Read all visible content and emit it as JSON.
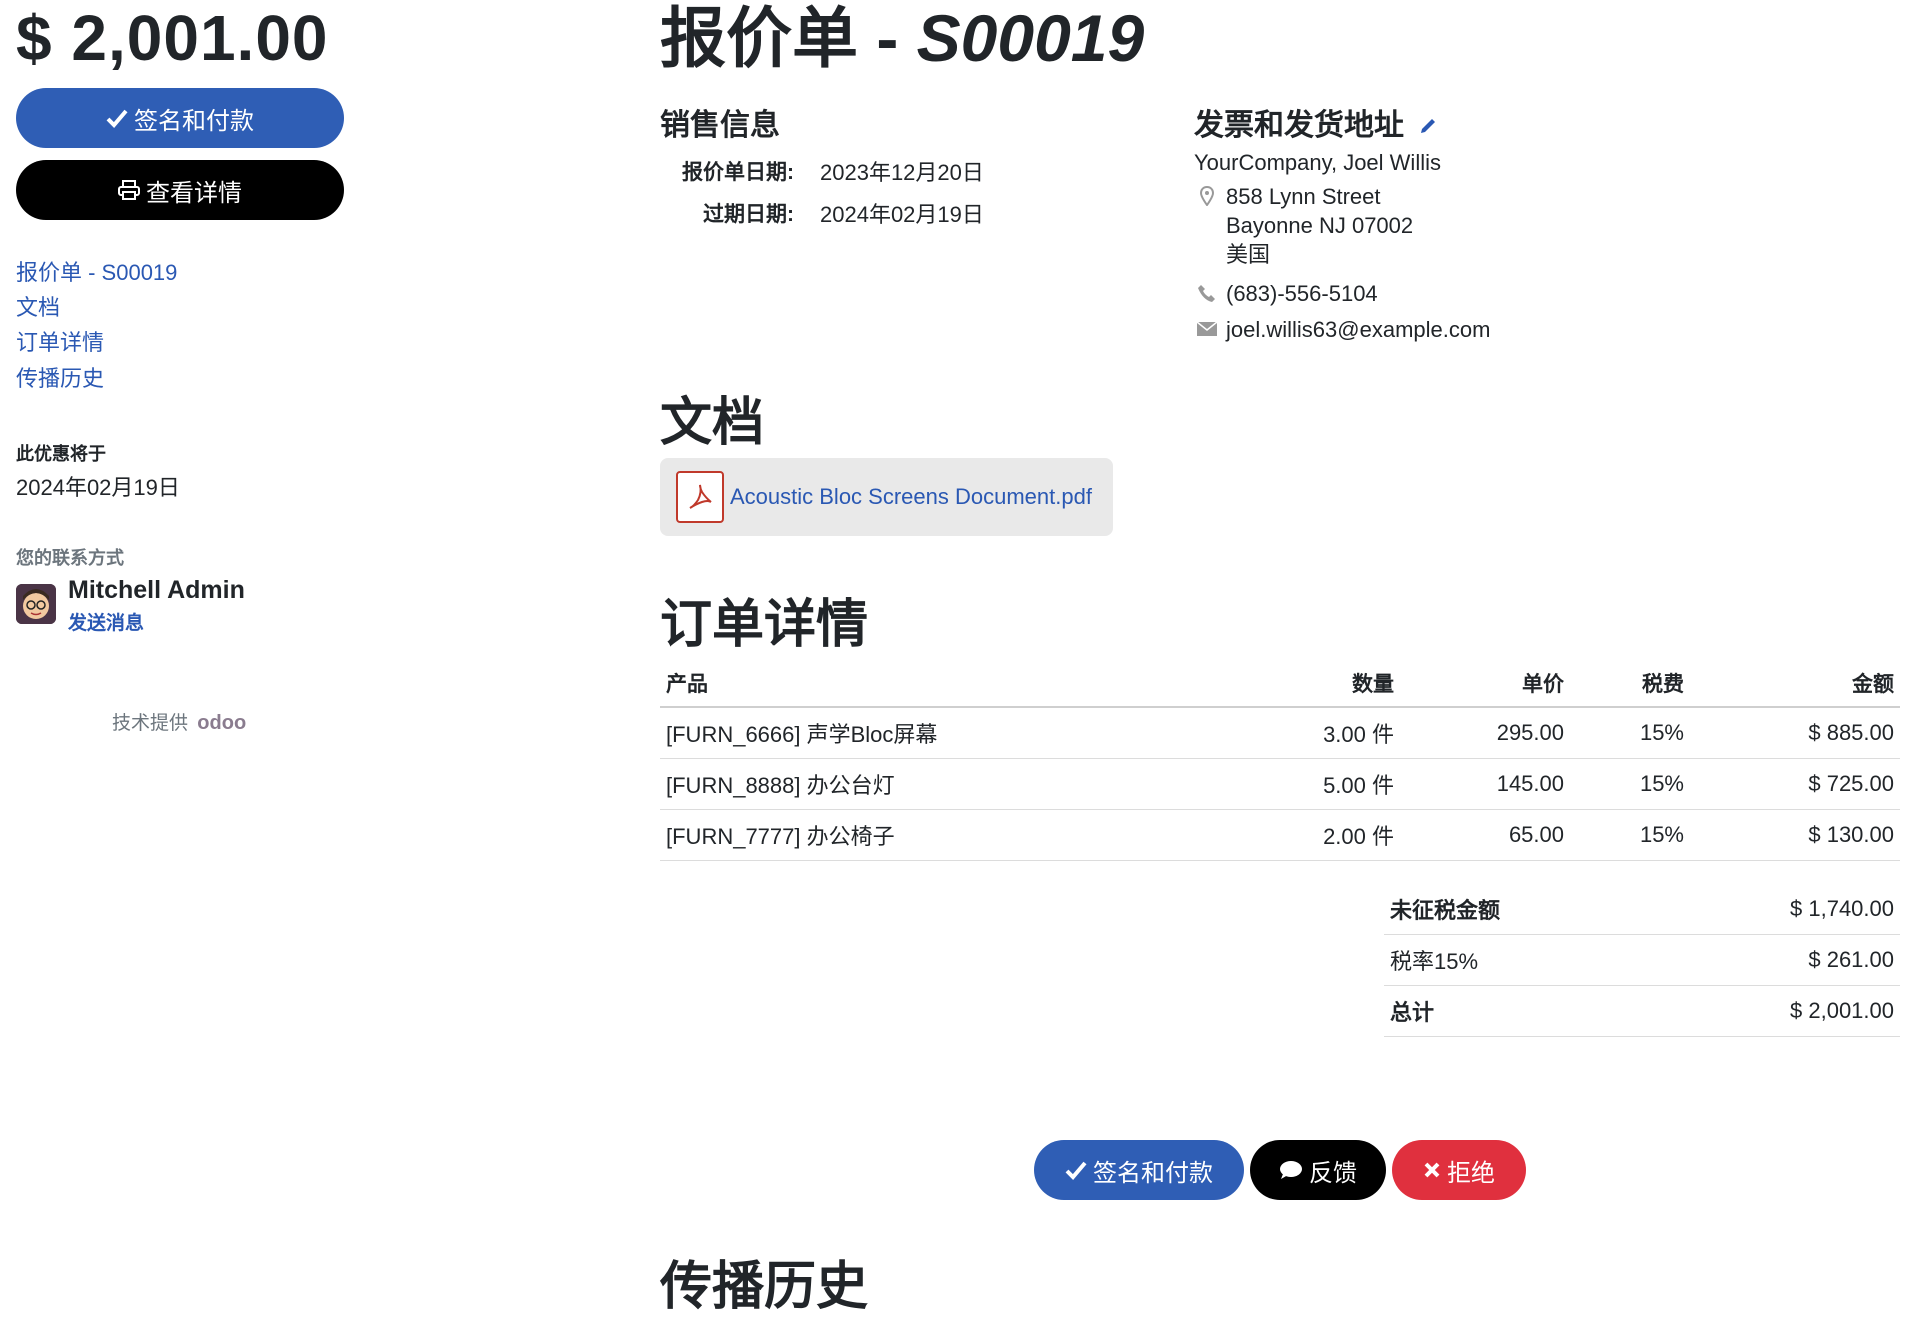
{
  "sidebar": {
    "amount": "$ 2,001.00",
    "sign_pay_label": "签名和付款",
    "view_details_label": "查看详情",
    "nav": [
      "报价单 - S00019",
      "文档",
      "订单详情",
      "传播历史"
    ],
    "offer_expires_label": "此优惠将于",
    "offer_expires_date": "2024年02月19日",
    "contact_label": "您的联系方式",
    "contact_name": "Mitchell Admin",
    "send_message": "发送消息",
    "powered_by": "技术提供",
    "odoo_logo_text": "odoo"
  },
  "header": {
    "title_prefix": "报价单 - ",
    "title_code": "S00019"
  },
  "sales_info": {
    "heading": "销售信息",
    "quote_date_label": "报价单日期:",
    "quote_date": "2023年12月20日",
    "expiry_label": "过期日期:",
    "expiry_date": "2024年02月19日"
  },
  "address": {
    "heading": "发票和发货地址",
    "company": "YourCompany, Joel Willis",
    "street": "858 Lynn Street",
    "city": "Bayonne NJ 07002",
    "country": "美国",
    "phone": "(683)-556-5104",
    "email": "joel.willis63@example.com"
  },
  "documents": {
    "heading": "文档",
    "file_name": "Acoustic Bloc Screens Document.pdf"
  },
  "order": {
    "heading": "订单详情",
    "columns": [
      "产品",
      "数量",
      "单价",
      "税费",
      "金额"
    ],
    "lines": [
      {
        "product": "[FURN_6666] 声学Bloc屏幕",
        "qty": "3.00 件",
        "price": "295.00",
        "tax": "15%",
        "amount": "$ 885.00"
      },
      {
        "product": "[FURN_8888] 办公台灯",
        "qty": "5.00 件",
        "price": "145.00",
        "tax": "15%",
        "amount": "$ 725.00"
      },
      {
        "product": "[FURN_7777] 办公椅子",
        "qty": "2.00 件",
        "price": "65.00",
        "tax": "15%",
        "amount": "$ 130.00"
      }
    ],
    "untaxed_label": "未征税金额",
    "untaxed_value": "$ 1,740.00",
    "tax_label": "税率15%",
    "tax_value": "$ 261.00",
    "total_label": "总计",
    "total_value": "$ 2,001.00"
  },
  "actions": {
    "sign_pay": "签名和付款",
    "feedback": "反馈",
    "reject": "拒绝"
  },
  "history": {
    "heading": "传播历史"
  },
  "colors": {
    "primary": "#2f5eb5",
    "link": "#2a58b3",
    "danger": "#e0303e",
    "dark": "#000000"
  }
}
